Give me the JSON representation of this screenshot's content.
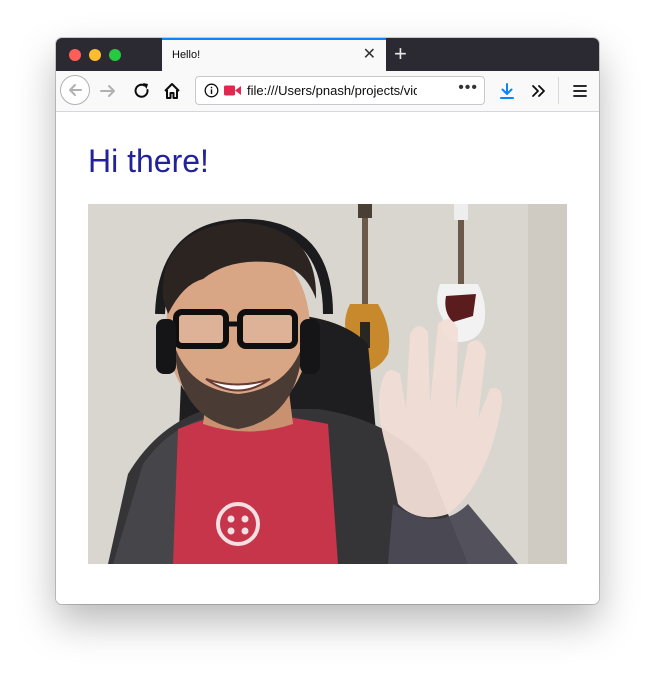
{
  "tab": {
    "title": "Hello!"
  },
  "toolbar": {
    "url": "file:///Users/pnash/projects/video"
  },
  "page": {
    "heading": "Hi there!"
  },
  "colors": {
    "heading": "#22229a",
    "tab_accent": "#0a84ff",
    "download": "#0a84ff",
    "camera_indicator": "#e22850"
  },
  "icons": [
    "back-arrow-icon",
    "forward-arrow-icon",
    "reload-icon",
    "home-icon",
    "info-icon",
    "camera-icon",
    "more-icon",
    "download-icon",
    "overflow-icon",
    "menu-icon"
  ]
}
